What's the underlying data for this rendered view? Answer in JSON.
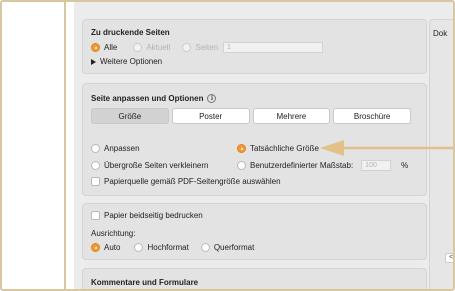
{
  "pages_section": {
    "title": "Zu druckende Seiten",
    "options": [
      {
        "label": "Alle",
        "selected": true
      },
      {
        "label": "Aktuell",
        "selected": false
      },
      {
        "label": "Seiten",
        "selected": false
      }
    ],
    "pages_value": "1",
    "more_options": "Weitere Optionen"
  },
  "fit_section": {
    "title": "Seite anpassen und Optionen",
    "info_icon": "i",
    "tabs": [
      {
        "label": "Größe",
        "active": true
      },
      {
        "label": "Poster",
        "active": false
      },
      {
        "label": "Mehrere",
        "active": false
      },
      {
        "label": "Broschüre",
        "active": false
      }
    ],
    "fit_label": "Anpassen",
    "actual_size_label": "Tatsächliche Größe",
    "shrink_label": "Übergroße Seiten verkleinern",
    "custom_scale_label": "Benutzerdefinierter Maßstab:",
    "custom_scale_value": "100",
    "percent_sign": "%",
    "paper_source_label": "Papierquelle gemäß PDF-Seitengröße auswählen"
  },
  "duplex_section": {
    "duplex_label": "Papier beidseitig bedrucken",
    "orientation_label": "Ausrichtung:",
    "orientation_options": [
      {
        "label": "Auto",
        "selected": true
      },
      {
        "label": "Hochformat",
        "selected": false
      },
      {
        "label": "Querformat",
        "selected": false
      }
    ]
  },
  "comments_section": {
    "title": "Kommentare und Formulare"
  },
  "preview": {
    "label": "Dok",
    "nav_prev": "<"
  },
  "colors": {
    "accent_orange": "#f39a38",
    "annotation_arrow": "#e2c187",
    "frame_border": "#d9c7a3"
  }
}
